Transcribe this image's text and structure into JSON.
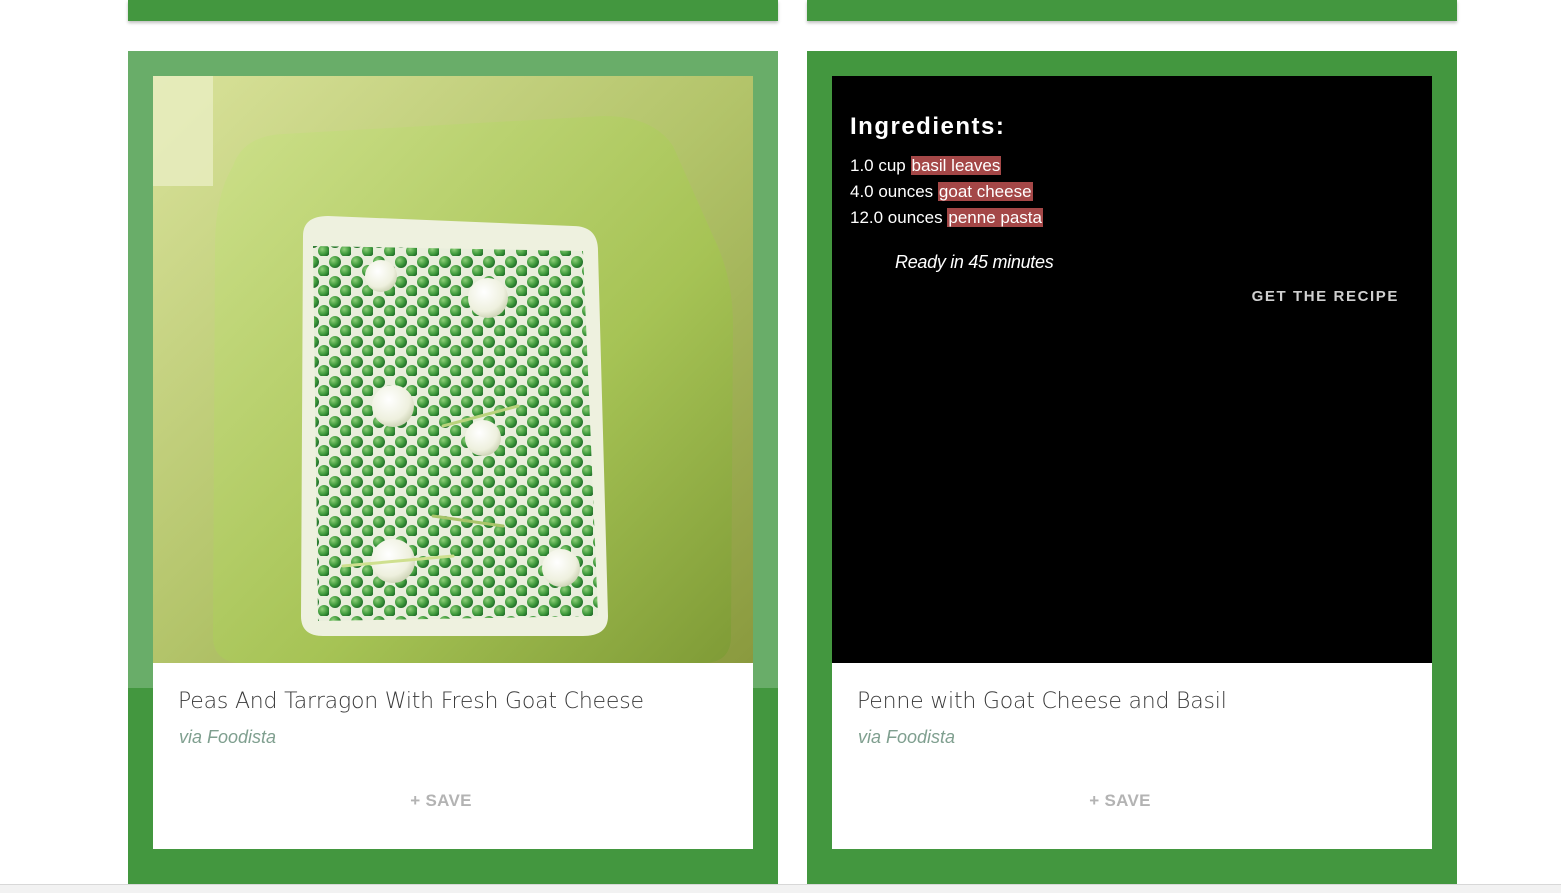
{
  "colors": {
    "card_green": "#43973f",
    "card_green_light": "#69ad69",
    "ingredient_highlight": "#a44747",
    "source_text": "#7f9f8f",
    "save_text": "#b3b3b3"
  },
  "cards": [
    {
      "title": "Peas And Tarragon With Fresh Goat Cheese",
      "source": "via Foodista",
      "save_label": "+ SAVE",
      "image": "peas-dish-photo"
    },
    {
      "title": "Penne with Goat Cheese and Basil",
      "source": "via Foodista",
      "save_label": "+ SAVE",
      "overlay": {
        "heading": "Ingredients:",
        "ingredients": [
          {
            "amount": "1.0 cup",
            "name": "basil leaves"
          },
          {
            "amount": "4.0 ounces",
            "name": "goat cheese"
          },
          {
            "amount": "12.0 ounces",
            "name": "penne pasta"
          }
        ],
        "ready_text": "Ready in 45 minutes",
        "cta_label": "GET THE RECIPE"
      }
    }
  ]
}
